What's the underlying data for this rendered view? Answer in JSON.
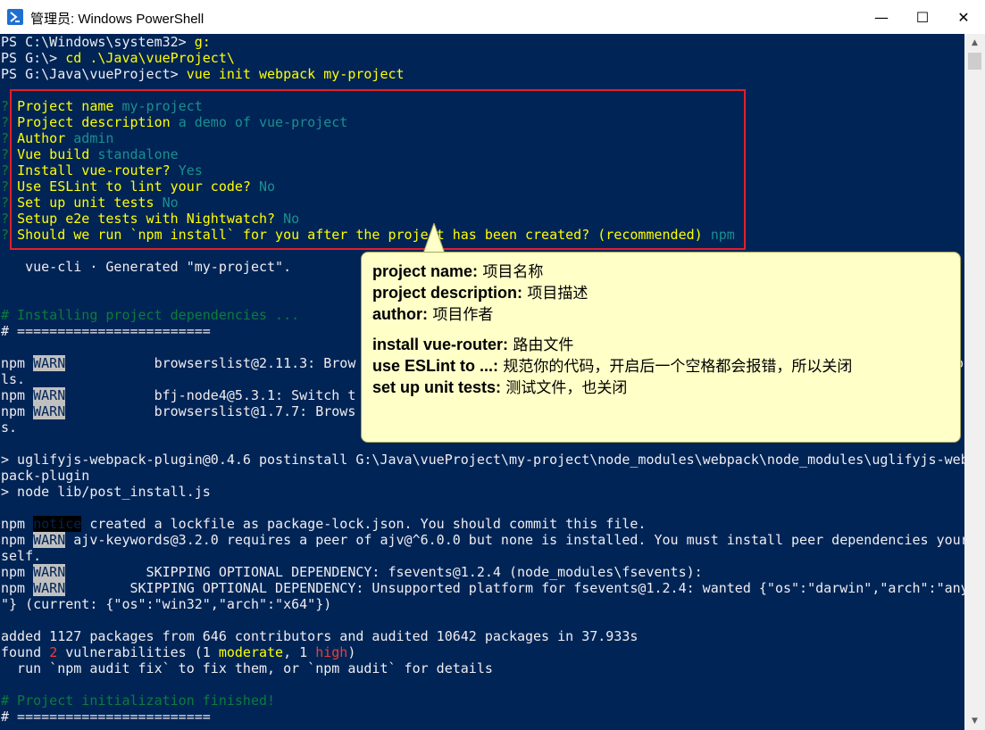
{
  "window": {
    "title": "管理员: Windows PowerShell",
    "minimize": "—",
    "maximize": "☐",
    "close": "✕"
  },
  "console": {
    "l1_prompt": "PS C:\\Windows\\system32> ",
    "l1_cmd": "g:",
    "l2_prompt": "PS G:\\> ",
    "l2_cmd": "cd .\\Java\\vueProject\\",
    "l3_prompt": "PS G:\\Java\\vueProject> ",
    "l3_cmd": "vue init webpack my-project",
    "questions": [
      {
        "q": "Project name ",
        "a": "my-project"
      },
      {
        "q": "Project description ",
        "a": "a demo of vue-project"
      },
      {
        "q": "Author ",
        "a": "admin"
      },
      {
        "q": "Vue build ",
        "a": "standalone"
      },
      {
        "q": "Install vue-router? ",
        "a": "Yes"
      },
      {
        "q": "Use ESLint to lint your code? ",
        "a": "No"
      },
      {
        "q": "Set up unit tests ",
        "a": "No"
      },
      {
        "q": "Setup e2e tests with Nightwatch? ",
        "a": "No"
      },
      {
        "q": "Should we run `npm install` for you after the project has been created? (recommended) ",
        "a": "npm"
      }
    ],
    "q_mark": "?",
    "generated": "   vue-cli · Generated \"my-project\".",
    "installing": "# Installing project dependencies ...",
    "sep": "# ========================",
    "npm": "npm ",
    "warn": "WARN",
    "notice": "notice",
    "w1_text": "           browserslist@2.11.3: Brow",
    "w1_end": "o",
    "w1_wrap": "ls.",
    "w2_text": "           bfj-node4@5.3.1: Switch t",
    "w3_text": "           browserslist@1.7.7: Brows",
    "w3_wrap": "s.",
    "uglify1": "> uglifyjs-webpack-plugin@0.4.6 postinstall G:\\Java\\vueProject\\my-project\\node_modules\\webpack\\node_modules\\uglifyjs-web",
    "uglify2": "pack-plugin",
    "uglify3": "> node lib/post_install.js",
    "n1_text": " created a lockfile as package-lock.json. You should commit this file.",
    "w4_text": " ajv-keywords@3.2.0 requires a peer of ajv@^6.0.0 but none is installed. You must install peer dependencies your",
    "w4_wrap": "self.",
    "w5_text": "          SKIPPING OPTIONAL DEPENDENCY: fsevents@1.2.4 (node_modules\\fsevents):",
    "w6_text": "        SKIPPING OPTIONAL DEPENDENCY: Unsupported platform for fsevents@1.2.4: wanted {\"os\":\"darwin\",\"arch\":\"any",
    "w6_wrap": "\"} (current: {\"os\":\"win32\",\"arch\":\"x64\"})",
    "added": "added 1127 packages from 646 contributors and audited 10642 packages in 37.933s",
    "found_a": "found ",
    "found_n": "2",
    "found_b": " vulnerabilities (1 ",
    "found_mod": "moderate",
    "found_c": ", 1 ",
    "found_high": "high",
    "found_d": ")",
    "run": "  run `npm audit fix` to fix them, or `npm audit` for details",
    "finished": "# Project initialization finished!",
    "sep2": "# ========================"
  },
  "callout": {
    "lines": [
      {
        "k": "project name:",
        "v": " 项目名称"
      },
      {
        "k": "project description:",
        "v": " 项目描述"
      },
      {
        "k": "author:",
        "v": " 项目作者"
      },
      {
        "k": "install vue-router:",
        "v": " 路由文件"
      },
      {
        "k": "use ESLint to ...:",
        "v": " 规范你的代码，开启后一个空格都会报错，所以关闭"
      },
      {
        "k": "set up unit tests:",
        "v": " 测试文件，也关闭"
      }
    ]
  },
  "colors": {
    "console_bg": "#012456",
    "highlight_box": "#e0202a",
    "callout_bg": "#ffffc8"
  }
}
